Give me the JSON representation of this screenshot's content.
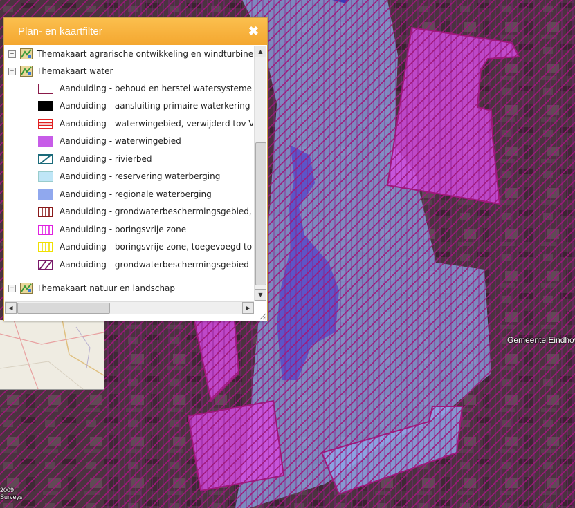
{
  "panel": {
    "title": "Plan- en kaartfilter",
    "close_symbol": "✖"
  },
  "tree": {
    "themes": [
      {
        "label": "Themakaart agrarische ontwikkeling en windturbines",
        "expander": "+"
      },
      {
        "label": "Themakaart water",
        "expander": "−"
      },
      {
        "label": "Themakaart natuur en landschap",
        "expander": "+"
      }
    ],
    "legend": [
      {
        "label": "Aanduiding - behoud en herstel watersystemen",
        "swatch": "outline-maroon"
      },
      {
        "label": "Aanduiding - aansluiting primaire waterkering",
        "swatch": "solid-black"
      },
      {
        "label": "Aanduiding - waterwingebied, verwijderd tov Verd",
        "swatch": "horizontal-red"
      },
      {
        "label": "Aanduiding - waterwingebied",
        "swatch": "solid-violet"
      },
      {
        "label": "Aanduiding - rivierbed",
        "swatch": "diagonal-teal"
      },
      {
        "label": "Aanduiding - reservering waterberging",
        "swatch": "solid-lightblue"
      },
      {
        "label": "Aanduiding - regionale waterberging",
        "swatch": "solid-blue"
      },
      {
        "label": "Aanduiding - grondwaterbeschermingsgebied, ve",
        "swatch": "vertical-maroon"
      },
      {
        "label": "Aanduiding - boringsvrije zone",
        "swatch": "vertical-magenta"
      },
      {
        "label": "Aanduiding - boringsvrije zone, toegevoegd tov V",
        "swatch": "vertical-yellow"
      },
      {
        "label": "Aanduiding - grondwaterbeschermingsgebied",
        "swatch": "diagonal-purple"
      }
    ]
  },
  "map": {
    "place_label": "Gemeente Eindhov",
    "copyright": "2009\nSurveys"
  },
  "icons": {
    "theme": "map-layer-icon",
    "close": "close-icon",
    "scroll_up": "scroll-up-icon",
    "scroll_down": "scroll-down-icon",
    "scroll_left": "scroll-left-icon",
    "scroll_right": "scroll-right-icon"
  },
  "colors": {
    "header": "#f7b03a",
    "hatch": "#a0187a",
    "waterwingebied": "#d24be0",
    "waterberging": "#8fa6e8",
    "rivierbed": "#5a4fc8"
  }
}
